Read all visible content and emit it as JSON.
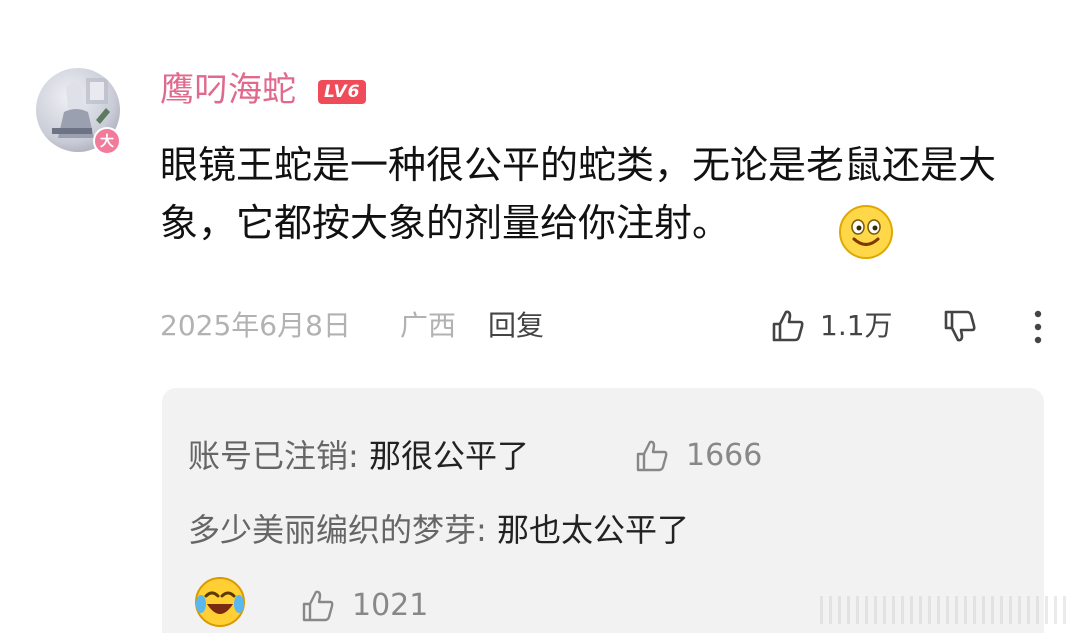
{
  "comment": {
    "username": "鹰叼海蛇",
    "level_badge": "LV6",
    "avatar_badge": "大",
    "text": "眼镜王蛇是一种很公平的蛇类，无论是老鼠还是大象，它都按大象的剂量给你注射。",
    "emoji_icon": "smile-emoji-icon",
    "date": "2025年6月8日",
    "location": "广西",
    "reply_label": "回复",
    "like_count": "1.1万"
  },
  "replies": [
    {
      "user": "账号已注销:",
      "text": " 那很公平了",
      "like_count": "1666"
    },
    {
      "user": "多少美丽编织的梦芽:",
      "text": " 那也太公平了",
      "emoji_icon": "laughing-crying-emoji-icon",
      "like_count": "1021"
    }
  ],
  "colors": {
    "username": "#e06a8d",
    "level_badge": "#f04b59",
    "reply_box": "#f2f2f2",
    "muted": "#b2b2b2"
  }
}
